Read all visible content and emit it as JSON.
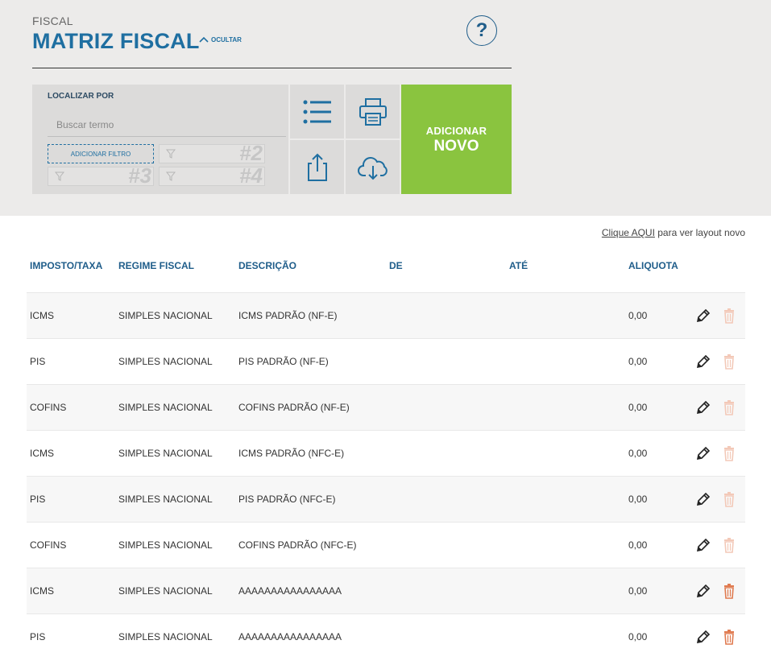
{
  "header": {
    "breadcrumb": "FISCAL",
    "title": "MATRIZ FISCAL",
    "toggle_label": "OCULTAR",
    "help_symbol": "?"
  },
  "search": {
    "label": "LOCALIZAR POR",
    "placeholder": "Buscar termo",
    "add_filter_label": "ADICIONAR FILTRO",
    "filter_slots": [
      "#2",
      "#3",
      "#4"
    ]
  },
  "toolbar": {
    "list_icon": "list-icon",
    "print_icon": "printer-icon",
    "share_icon": "share-icon",
    "download_icon": "cloud-download-icon"
  },
  "add_new": {
    "line1": "ADICIONAR",
    "line2": "NOVO"
  },
  "layout_note": {
    "link": "Clique AQUI",
    "text": " para ver layout novo"
  },
  "table": {
    "headers": [
      "IMPOSTO/TAXA",
      "REGIME FISCAL",
      "DESCRIÇÃO",
      "DE",
      "ATÉ",
      "ALIQUOTA"
    ],
    "rows": [
      {
        "imposto": "ICMS",
        "regime": "SIMPLES NACIONAL",
        "descricao": "ICMS PADRÃO (NF-E)",
        "aliquota": "0,00",
        "delete_enabled": false
      },
      {
        "imposto": "PIS",
        "regime": "SIMPLES NACIONAL",
        "descricao": "PIS PADRÃO (NF-E)",
        "aliquota": "0,00",
        "delete_enabled": false
      },
      {
        "imposto": "COFINS",
        "regime": "SIMPLES NACIONAL",
        "descricao": "COFINS PADRÃO (NF-E)",
        "aliquota": "0,00",
        "delete_enabled": false
      },
      {
        "imposto": "ICMS",
        "regime": "SIMPLES NACIONAL",
        "descricao": "ICMS PADRÃO (NFC-E)",
        "aliquota": "0,00",
        "delete_enabled": false
      },
      {
        "imposto": "PIS",
        "regime": "SIMPLES NACIONAL",
        "descricao": "PIS PADRÃO (NFC-E)",
        "aliquota": "0,00",
        "delete_enabled": false
      },
      {
        "imposto": "COFINS",
        "regime": "SIMPLES NACIONAL",
        "descricao": "COFINS PADRÃO (NFC-E)",
        "aliquota": "0,00",
        "delete_enabled": false
      },
      {
        "imposto": "ICMS",
        "regime": "SIMPLES NACIONAL",
        "descricao": "AAAAAAAAAAAAAAAA",
        "aliquota": "0,00",
        "delete_enabled": true
      },
      {
        "imposto": "PIS",
        "regime": "SIMPLES NACIONAL",
        "descricao": "AAAAAAAAAAAAAAAA",
        "aliquota": "0,00",
        "delete_enabled": true
      }
    ]
  },
  "colors": {
    "brand_blue": "#1f6fa1",
    "accent_green": "#8ac43f",
    "delete_enabled": "#e07a4f",
    "delete_disabled": "#f3c9b8"
  }
}
